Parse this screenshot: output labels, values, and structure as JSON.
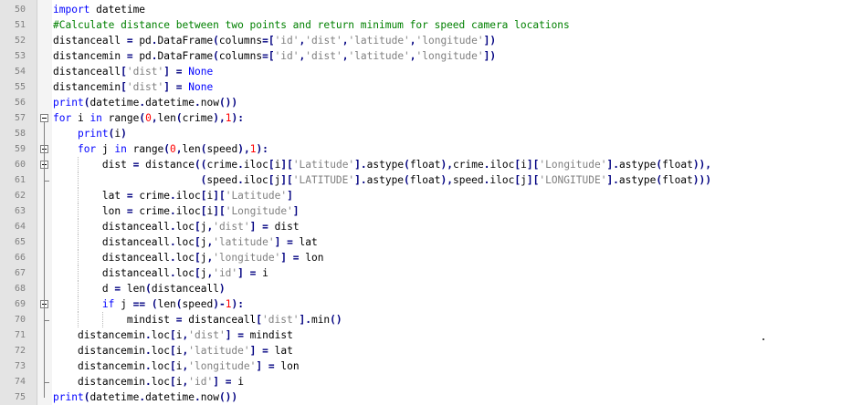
{
  "editor": {
    "lines": [
      {
        "n": "50",
        "i": 0,
        "t": [
          [
            "kw",
            "import"
          ],
          [
            "",
            "datetime"
          ]
        ]
      },
      {
        "n": "51",
        "i": 0,
        "t": [
          [
            "cm",
            "#Calculate distance between two points and return minimum for speed camera locations"
          ]
        ]
      },
      {
        "n": "52",
        "i": 0,
        "t": [
          [
            "",
            "distanceall "
          ],
          [
            "op",
            "="
          ],
          [
            "",
            " pd"
          ],
          [
            "op",
            "."
          ],
          [
            "",
            "DataFrame"
          ],
          [
            "op",
            "("
          ],
          [
            "",
            "columns"
          ],
          [
            "op",
            "=["
          ],
          [
            "str",
            "'id'"
          ],
          [
            "op",
            ","
          ],
          [
            "str",
            "'dist'"
          ],
          [
            "op",
            ","
          ],
          [
            "str",
            "'latitude'"
          ],
          [
            "op",
            ","
          ],
          [
            "str",
            "'longitude'"
          ],
          [
            "op",
            "])"
          ]
        ]
      },
      {
        "n": "53",
        "i": 0,
        "t": [
          [
            "",
            "distancemin "
          ],
          [
            "op",
            "="
          ],
          [
            "",
            " pd"
          ],
          [
            "op",
            "."
          ],
          [
            "",
            "DataFrame"
          ],
          [
            "op",
            "("
          ],
          [
            "",
            "columns"
          ],
          [
            "op",
            "=["
          ],
          [
            "str",
            "'id'"
          ],
          [
            "op",
            ","
          ],
          [
            "str",
            "'dist'"
          ],
          [
            "op",
            ","
          ],
          [
            "str",
            "'latitude'"
          ],
          [
            "op",
            ","
          ],
          [
            "str",
            "'longitude'"
          ],
          [
            "op",
            "])"
          ]
        ]
      },
      {
        "n": "54",
        "i": 0,
        "t": [
          [
            "",
            "distanceall"
          ],
          [
            "op",
            "["
          ],
          [
            "str",
            "'dist'"
          ],
          [
            "op",
            "]"
          ],
          [
            "",
            " "
          ],
          [
            "op",
            "="
          ],
          [
            "",
            " "
          ],
          [
            "kw",
            "None"
          ]
        ]
      },
      {
        "n": "55",
        "i": 0,
        "t": [
          [
            "",
            "distancemin"
          ],
          [
            "op",
            "["
          ],
          [
            "str",
            "'dist'"
          ],
          [
            "op",
            "]"
          ],
          [
            "",
            " "
          ],
          [
            "op",
            "="
          ],
          [
            "",
            " "
          ],
          [
            "kw",
            "None"
          ]
        ]
      },
      {
        "n": "56",
        "i": 0,
        "t": [
          [
            "kw",
            "print"
          ],
          [
            "op",
            "("
          ],
          [
            "",
            "datetime"
          ],
          [
            "op",
            "."
          ],
          [
            "",
            "datetime"
          ],
          [
            "op",
            "."
          ],
          [
            "",
            "now"
          ],
          [
            "op",
            "())"
          ]
        ]
      },
      {
        "n": "57",
        "i": 0,
        "t": [
          [
            "kw",
            "for"
          ],
          [
            "",
            " i "
          ],
          [
            "kw",
            "in"
          ],
          [
            "",
            " range"
          ],
          [
            "op",
            "("
          ],
          [
            "num",
            "0"
          ],
          [
            "op",
            ","
          ],
          [
            "",
            "len"
          ],
          [
            "op",
            "("
          ],
          [
            "",
            "crime"
          ],
          [
            "op",
            "),"
          ],
          [
            "num",
            "1"
          ],
          [
            "op",
            "):"
          ]
        ]
      },
      {
        "n": "58",
        "i": 1,
        "t": [
          [
            "kw",
            "print"
          ],
          [
            "op",
            "("
          ],
          [
            "",
            "i"
          ],
          [
            "op",
            ")"
          ]
        ]
      },
      {
        "n": "59",
        "i": 1,
        "t": [
          [
            "kw",
            "for"
          ],
          [
            "",
            " j "
          ],
          [
            "kw",
            "in"
          ],
          [
            "",
            " range"
          ],
          [
            "op",
            "("
          ],
          [
            "num",
            "0"
          ],
          [
            "op",
            ","
          ],
          [
            "",
            "len"
          ],
          [
            "op",
            "("
          ],
          [
            "",
            "speed"
          ],
          [
            "op",
            "),"
          ],
          [
            "num",
            "1"
          ],
          [
            "op",
            "):"
          ]
        ]
      },
      {
        "n": "60",
        "i": 2,
        "t": [
          [
            "",
            "dist "
          ],
          [
            "op",
            "="
          ],
          [
            "",
            " distance"
          ],
          [
            "op",
            "(("
          ],
          [
            "",
            "crime"
          ],
          [
            "op",
            "."
          ],
          [
            "",
            "iloc"
          ],
          [
            "op",
            "["
          ],
          [
            "",
            "i"
          ],
          [
            "op",
            "]["
          ],
          [
            "str",
            "'Latitude'"
          ],
          [
            "op",
            "]."
          ],
          [
            "",
            "astype"
          ],
          [
            "op",
            "("
          ],
          [
            "",
            "float"
          ],
          [
            "op",
            "),"
          ],
          [
            "",
            "crime"
          ],
          [
            "op",
            "."
          ],
          [
            "",
            "iloc"
          ],
          [
            "op",
            "["
          ],
          [
            "",
            "i"
          ],
          [
            "op",
            "]["
          ],
          [
            "str",
            "'Longitude'"
          ],
          [
            "op",
            "]."
          ],
          [
            "",
            "astype"
          ],
          [
            "op",
            "("
          ],
          [
            "",
            "float"
          ],
          [
            "op",
            ")),"
          ]
        ]
      },
      {
        "n": "61",
        "i": 2,
        "pad": "                ",
        "t": [
          [
            "op",
            "("
          ],
          [
            "",
            "speed"
          ],
          [
            "op",
            "."
          ],
          [
            "",
            "iloc"
          ],
          [
            "op",
            "["
          ],
          [
            "",
            "j"
          ],
          [
            "op",
            "]["
          ],
          [
            "str",
            "'LATITUDE'"
          ],
          [
            "op",
            "]."
          ],
          [
            "",
            "astype"
          ],
          [
            "op",
            "("
          ],
          [
            "",
            "float"
          ],
          [
            "op",
            "),"
          ],
          [
            "",
            "speed"
          ],
          [
            "op",
            "."
          ],
          [
            "",
            "iloc"
          ],
          [
            "op",
            "["
          ],
          [
            "",
            "j"
          ],
          [
            "op",
            "]["
          ],
          [
            "str",
            "'LONGITUDE'"
          ],
          [
            "op",
            "]."
          ],
          [
            "",
            "astype"
          ],
          [
            "op",
            "("
          ],
          [
            "",
            "float"
          ],
          [
            "op",
            ")))"
          ]
        ]
      },
      {
        "n": "62",
        "i": 2,
        "t": [
          [
            "",
            "lat "
          ],
          [
            "op",
            "="
          ],
          [
            "",
            " crime"
          ],
          [
            "op",
            "."
          ],
          [
            "",
            "iloc"
          ],
          [
            "op",
            "["
          ],
          [
            "",
            "i"
          ],
          [
            "op",
            "]["
          ],
          [
            "str",
            "'Latitude'"
          ],
          [
            "op",
            "]"
          ]
        ]
      },
      {
        "n": "63",
        "i": 2,
        "t": [
          [
            "",
            "lon "
          ],
          [
            "op",
            "="
          ],
          [
            "",
            " crime"
          ],
          [
            "op",
            "."
          ],
          [
            "",
            "iloc"
          ],
          [
            "op",
            "["
          ],
          [
            "",
            "i"
          ],
          [
            "op",
            "]["
          ],
          [
            "str",
            "'Longitude'"
          ],
          [
            "op",
            "]"
          ]
        ]
      },
      {
        "n": "64",
        "i": 2,
        "t": [
          [
            "",
            "distanceall"
          ],
          [
            "op",
            "."
          ],
          [
            "",
            "loc"
          ],
          [
            "op",
            "["
          ],
          [
            "",
            "j"
          ],
          [
            "op",
            ","
          ],
          [
            "str",
            "'dist'"
          ],
          [
            "op",
            "]"
          ],
          [
            "",
            " "
          ],
          [
            "op",
            "="
          ],
          [
            "",
            " dist"
          ]
        ]
      },
      {
        "n": "65",
        "i": 2,
        "t": [
          [
            "",
            "distanceall"
          ],
          [
            "op",
            "."
          ],
          [
            "",
            "loc"
          ],
          [
            "op",
            "["
          ],
          [
            "",
            "j"
          ],
          [
            "op",
            ","
          ],
          [
            "str",
            "'latitude'"
          ],
          [
            "op",
            "]"
          ],
          [
            "",
            " "
          ],
          [
            "op",
            "="
          ],
          [
            "",
            " lat"
          ]
        ]
      },
      {
        "n": "66",
        "i": 2,
        "t": [
          [
            "",
            "distanceall"
          ],
          [
            "op",
            "."
          ],
          [
            "",
            "loc"
          ],
          [
            "op",
            "["
          ],
          [
            "",
            "j"
          ],
          [
            "op",
            ","
          ],
          [
            "str",
            "'longitude'"
          ],
          [
            "op",
            "]"
          ],
          [
            "",
            " "
          ],
          [
            "op",
            "="
          ],
          [
            "",
            " lon"
          ]
        ]
      },
      {
        "n": "67",
        "i": 2,
        "t": [
          [
            "",
            "distanceall"
          ],
          [
            "op",
            "."
          ],
          [
            "",
            "loc"
          ],
          [
            "op",
            "["
          ],
          [
            "",
            "j"
          ],
          [
            "op",
            ","
          ],
          [
            "str",
            "'id'"
          ],
          [
            "op",
            "]"
          ],
          [
            "",
            " "
          ],
          [
            "op",
            "="
          ],
          [
            "",
            " i"
          ]
        ]
      },
      {
        "n": "68",
        "i": 2,
        "t": [
          [
            "",
            "d "
          ],
          [
            "op",
            "="
          ],
          [
            "",
            " len"
          ],
          [
            "op",
            "("
          ],
          [
            "",
            "distanceall"
          ],
          [
            "op",
            ")"
          ]
        ]
      },
      {
        "n": "69",
        "i": 2,
        "t": [
          [
            "kw",
            "if"
          ],
          [
            "",
            " j "
          ],
          [
            "op",
            "=="
          ],
          [
            "",
            " "
          ],
          [
            "op",
            "("
          ],
          [
            "",
            "len"
          ],
          [
            "op",
            "("
          ],
          [
            "",
            "speed"
          ],
          [
            "op",
            ")-"
          ],
          [
            "num",
            "1"
          ],
          [
            "op",
            "):"
          ]
        ]
      },
      {
        "n": "70",
        "i": 3,
        "t": [
          [
            "",
            "mindist "
          ],
          [
            "op",
            "="
          ],
          [
            "",
            " distanceall"
          ],
          [
            "op",
            "["
          ],
          [
            "str",
            "'dist'"
          ],
          [
            "op",
            "]."
          ],
          [
            "",
            "min"
          ],
          [
            "op",
            "()"
          ]
        ]
      },
      {
        "n": "71",
        "i": 1,
        "t": [
          [
            "",
            "distancemin"
          ],
          [
            "op",
            "."
          ],
          [
            "",
            "loc"
          ],
          [
            "op",
            "["
          ],
          [
            "",
            "i"
          ],
          [
            "op",
            ","
          ],
          [
            "str",
            "'dist'"
          ],
          [
            "op",
            "]"
          ],
          [
            "",
            " "
          ],
          [
            "op",
            "="
          ],
          [
            "",
            " mindist"
          ]
        ]
      },
      {
        "n": "72",
        "i": 1,
        "t": [
          [
            "",
            "distancemin"
          ],
          [
            "op",
            "."
          ],
          [
            "",
            "loc"
          ],
          [
            "op",
            "["
          ],
          [
            "",
            "i"
          ],
          [
            "op",
            ","
          ],
          [
            "str",
            "'latitude'"
          ],
          [
            "op",
            "]"
          ],
          [
            "",
            " "
          ],
          [
            "op",
            "="
          ],
          [
            "",
            " lat"
          ]
        ]
      },
      {
        "n": "73",
        "i": 1,
        "t": [
          [
            "",
            "distancemin"
          ],
          [
            "op",
            "."
          ],
          [
            "",
            "loc"
          ],
          [
            "op",
            "["
          ],
          [
            "",
            "i"
          ],
          [
            "op",
            ","
          ],
          [
            "str",
            "'longitude'"
          ],
          [
            "op",
            "]"
          ],
          [
            "",
            " "
          ],
          [
            "op",
            "="
          ],
          [
            "",
            " lon"
          ]
        ]
      },
      {
        "n": "74",
        "i": 1,
        "t": [
          [
            "",
            "distancemin"
          ],
          [
            "op",
            "."
          ],
          [
            "",
            "loc"
          ],
          [
            "op",
            "["
          ],
          [
            "",
            "i"
          ],
          [
            "op",
            ","
          ],
          [
            "str",
            "'id'"
          ],
          [
            "op",
            "]"
          ],
          [
            "",
            " "
          ],
          [
            "op",
            "="
          ],
          [
            "",
            " i"
          ]
        ]
      },
      {
        "n": "75",
        "i": 0,
        "t": [
          [
            "kw",
            "print"
          ],
          [
            "op",
            "("
          ],
          [
            "",
            "datetime"
          ],
          [
            "op",
            "."
          ],
          [
            "",
            "datetime"
          ],
          [
            "op",
            "."
          ],
          [
            "",
            "now"
          ],
          [
            "op",
            "())"
          ]
        ]
      }
    ]
  },
  "folding": {
    "markers": [
      "57",
      "59",
      "60",
      "69"
    ]
  },
  "colors": {
    "keyword": "#0000ff",
    "comment": "#008000",
    "string": "#808080",
    "number": "#ff0000",
    "operator": "#000080",
    "gutter": "#e4e4e4"
  }
}
